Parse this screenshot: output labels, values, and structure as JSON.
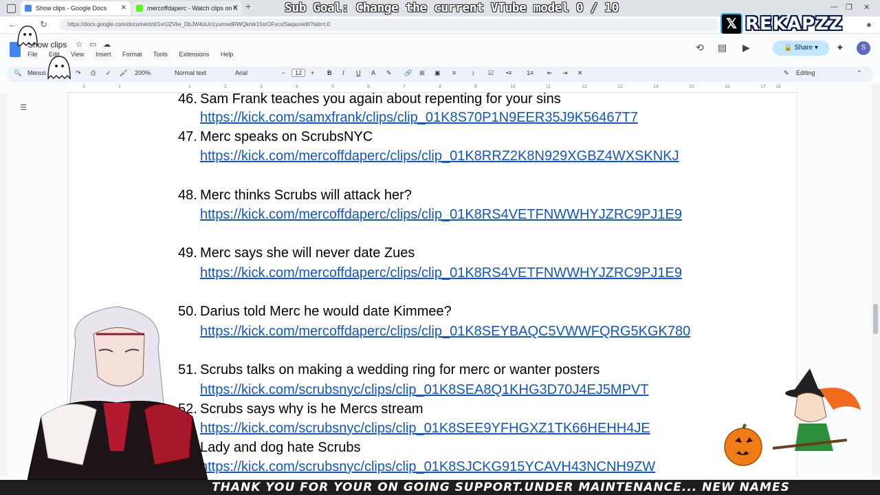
{
  "browser": {
    "tabs": [
      {
        "label": "Show clips - Google Docs",
        "favicon_color": "#4285f4"
      },
      {
        "label": "mercoffdaperc - Watch clips on K",
        "favicon_color": "#53fc18"
      }
    ],
    "url": "https://docs.google.com/document/d/1vrUZVlw_DbJW4oUo1yumwdRWQkmk15srOFxcxlSaqso/edit?tab=t.0"
  },
  "stream_overlay": {
    "sub_goal": "Sub Goal: Change the current VTube model  0 / 10",
    "brand": "REKAPZZ",
    "ticker": "THANK YOU FOR YOUR ON GOING SUPPORT.UNDER MAINTENANCE... NEW NAMES"
  },
  "docs": {
    "title": "Show clips",
    "menu": [
      "File",
      "Edit",
      "View",
      "Insert",
      "Format",
      "Tools",
      "Extensions",
      "Help"
    ],
    "share_label": "Share",
    "avatar_initial": "S",
    "toolbar": {
      "search": "Menus",
      "zoom": "200%",
      "style": "Normal text",
      "font": "Arial",
      "font_size": "12",
      "mode": "Editing"
    },
    "ruler_ticks": [
      "2",
      "1",
      "1",
      "2",
      "3",
      "4",
      "5",
      "6",
      "7",
      "8",
      "9",
      "10",
      "11",
      "12",
      "13",
      "14",
      "15",
      "16",
      "17",
      "18"
    ]
  },
  "entries": [
    {
      "num": "46.",
      "title": "Sam Frank teaches you again about repenting for your sins",
      "link": "https://kick.com/samxfrank/clips/clip_01K8S70P1N9EER35J9K56467T7"
    },
    {
      "num": "47.",
      "title": "Merc speaks on ScrubsNYC",
      "link": "https://kick.com/mercoffdaperc/clips/clip_01K8RRZ2K8N929XGBZ4WXSKNKJ"
    },
    {
      "num": "48.",
      "title": "Merc thinks Scrubs will attack her?",
      "link": "https://kick.com/mercoffdaperc/clips/clip_01K8RS4VETFNWWHYJZRC9PJ1E9"
    },
    {
      "num": "49.",
      "title": "Merc says she will never date Zues",
      "link": "https://kick.com/mercoffdaperc/clips/clip_01K8RS4VETFNWWHYJZRC9PJ1E9"
    },
    {
      "num": "50.",
      "title": "Darius told Merc he would date Kimmee?",
      "link": "https://kick.com/mercoffdaperc/clips/clip_01K8SEYBAQC5VWWFQRG5KGK780"
    },
    {
      "num": "51.",
      "title": "Scrubs talks on making a wedding ring for merc or wanter posters",
      "link": "https://kick.com/scrubsnyc/clips/clip_01K8SEA8Q1KHG3D70J4EJ5MPVT"
    },
    {
      "num": "52.",
      "title": "Scrubs says why is he Mercs stream",
      "link": "https://kick.com/scrubsnyc/clips/clip_01K8SEE9YFHGXZ1TK66HEHH4JE"
    },
    {
      "num": "",
      "title": "Lady and dog hate Scrubs",
      "link": "https://kick.com/scrubsnyc/clips/clip_01K8SJCKG915YCAVH43NCNH9ZW"
    }
  ]
}
